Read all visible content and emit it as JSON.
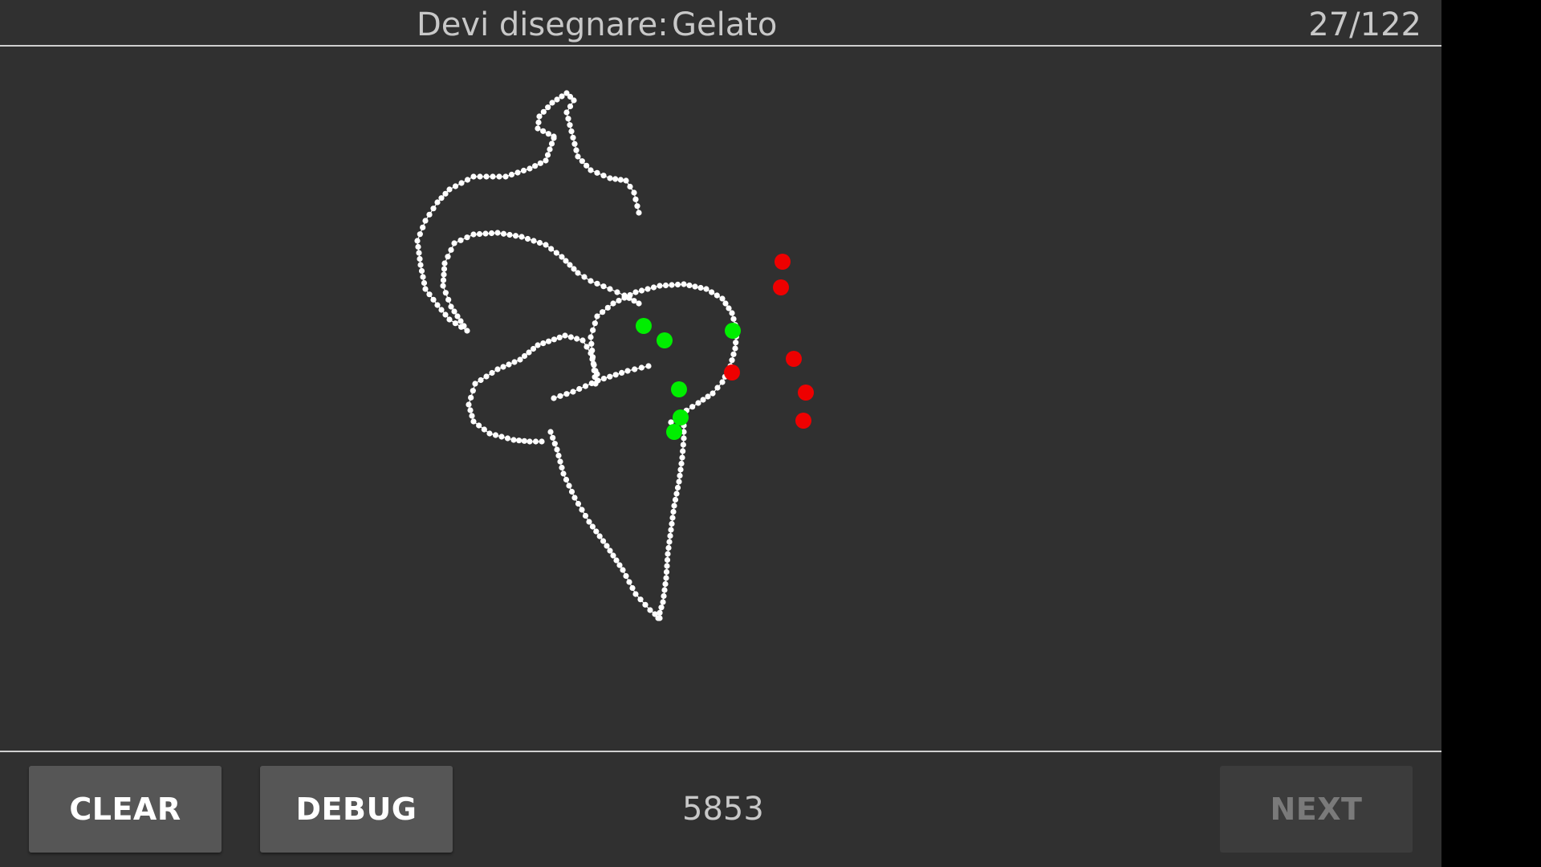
{
  "header": {
    "prompt_label": "Devi disegnare:",
    "prompt_word": "Gelato",
    "counter": "27/122"
  },
  "footer": {
    "clear_label": "CLEAR",
    "debug_label": "DEBUG",
    "score": "5853",
    "next_label": "NEXT",
    "next_enabled": false
  },
  "colors": {
    "background": "#303030",
    "stroke": "#ffffff",
    "point_good": "#00ee00",
    "point_bad": "#ee0000",
    "text": "#c8c8c8",
    "button": "#565656",
    "button_disabled": "#3c3c3c"
  }
}
